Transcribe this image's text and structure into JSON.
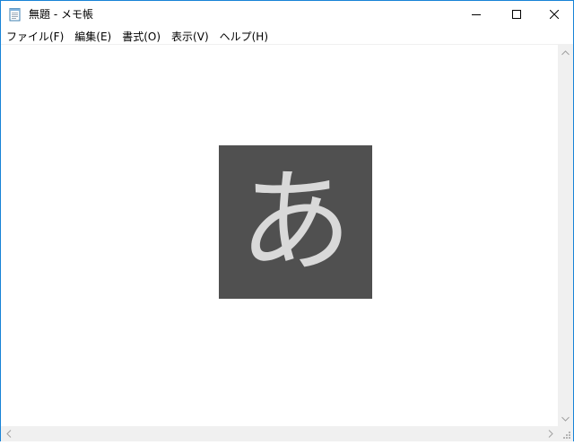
{
  "window": {
    "title": "無題 - メモ帳",
    "accent_color": "#1883d7"
  },
  "caption_buttons": {
    "minimize_icon": "minimize-icon",
    "maximize_icon": "maximize-icon",
    "close_icon": "close-icon"
  },
  "menu": {
    "items": [
      {
        "label": "ファイル(F)"
      },
      {
        "label": "編集(E)"
      },
      {
        "label": "書式(O)"
      },
      {
        "label": "表示(V)"
      },
      {
        "label": "ヘルプ(H)"
      }
    ]
  },
  "editor": {
    "content": "",
    "ime_indicator": {
      "glyph": "あ",
      "background": "#505050",
      "foreground": "#d9d9d9"
    }
  },
  "scrollbars": {
    "vertical": {
      "up_icon": "chevron-up-icon",
      "down_icon": "chevron-down-icon"
    },
    "horizontal": {
      "left_icon": "chevron-left-icon",
      "right_icon": "chevron-right-icon"
    }
  }
}
